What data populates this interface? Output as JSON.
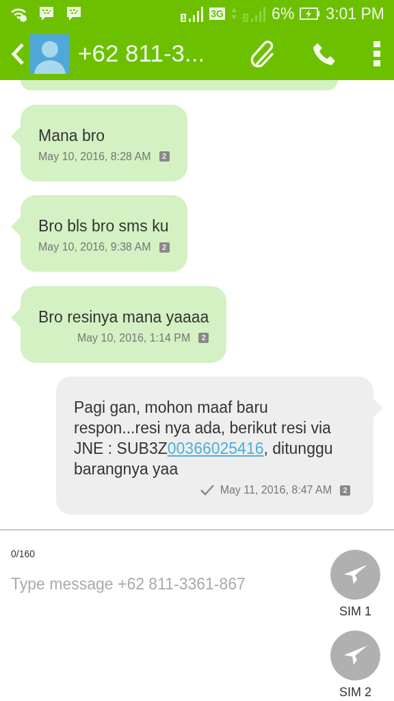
{
  "status_bar": {
    "sims": [
      {
        "label": "1",
        "active": true
      },
      {
        "label": "2",
        "active": false
      }
    ],
    "network": "3G",
    "battery": "6%",
    "time": "3:01 PM"
  },
  "toolbar": {
    "title": "+62 811-3..."
  },
  "messages": [
    {
      "kind": "sliver"
    },
    {
      "kind": "incoming",
      "parts": [
        {
          "text": "Mana bro"
        }
      ],
      "time": "May 10, 2016, 8:28 AM",
      "sim": "2",
      "delivered": false
    },
    {
      "kind": "incoming",
      "parts": [
        {
          "text": "Bro bls bro sms ku"
        }
      ],
      "time": "May 10, 2016, 9:38 AM",
      "sim": "2",
      "delivered": false
    },
    {
      "kind": "incoming",
      "parts": [
        {
          "text": "Bro resinya mana yaaaa"
        }
      ],
      "time": "May 10, 2016, 1:14 PM",
      "sim": "2",
      "delivered": false
    },
    {
      "kind": "outgoing",
      "parts": [
        {
          "text": "Pagi gan, mohon maaf baru respon...resi nya ada, berikut resi via JNE : SUB3Z"
        },
        {
          "text": "00366025416",
          "link": true
        },
        {
          "text": ", ditunggu barangnya yaa"
        }
      ],
      "time": "May 11, 2016, 8:47 AM",
      "sim": "2",
      "delivered": true
    }
  ],
  "compose": {
    "counter": "0/160",
    "placeholder": "Type message +62 811-3361-867",
    "send_buttons": [
      {
        "label": "SIM 1"
      },
      {
        "label": "SIM 2"
      }
    ]
  }
}
